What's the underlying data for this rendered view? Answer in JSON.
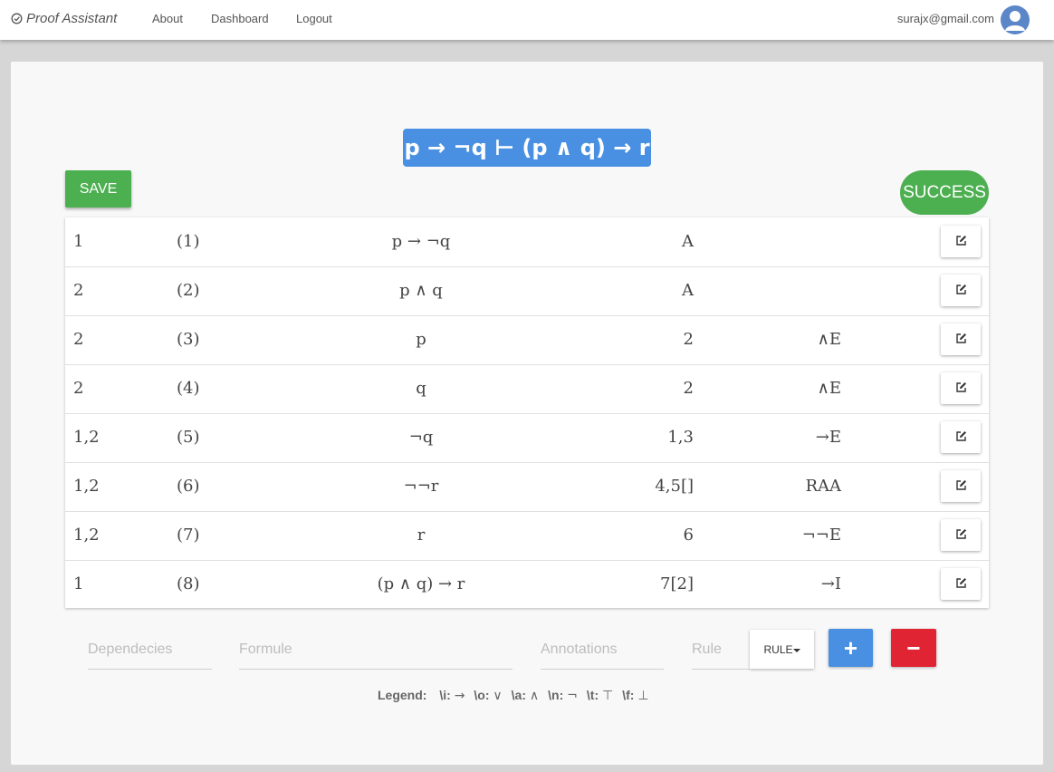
{
  "navbar": {
    "brand": "Proof Assistant",
    "links": [
      "About",
      "Dashboard",
      "Logout"
    ],
    "user_email": "surajx@gmail.com"
  },
  "sequent": "p → ¬q ⊢ (p ∧ q) → r",
  "save_label": "SAVE",
  "status_label": "SUCCESS",
  "colors": {
    "sequent_bg": "#4a90e2",
    "save": "#4caf50",
    "success": "#4caf50",
    "add": "#4a90e2",
    "remove": "#e02433"
  },
  "proof": {
    "rows": [
      {
        "deps": "1",
        "line": "(1)",
        "formula": "p → ¬q",
        "annotation": "A",
        "rule": ""
      },
      {
        "deps": "2",
        "line": "(2)",
        "formula": "p ∧ q",
        "annotation": "A",
        "rule": ""
      },
      {
        "deps": "2",
        "line": "(3)",
        "formula": "p",
        "annotation": "2",
        "rule": "∧E"
      },
      {
        "deps": "2",
        "line": "(4)",
        "formula": "q",
        "annotation": "2",
        "rule": "∧E"
      },
      {
        "deps": "1,2",
        "line": "(5)",
        "formula": "¬q",
        "annotation": "1,3",
        "rule": "→E"
      },
      {
        "deps": "1,2",
        "line": "(6)",
        "formula": "¬¬r",
        "annotation": "4,5[]",
        "rule": "RAA"
      },
      {
        "deps": "1,2",
        "line": "(7)",
        "formula": "r",
        "annotation": "6",
        "rule": "¬¬E"
      },
      {
        "deps": "1",
        "line": "(8)",
        "formula": "(p ∧ q) → r",
        "annotation": "7[2]",
        "rule": "→I"
      }
    ]
  },
  "input": {
    "deps_placeholder": "Dependecies",
    "formula_placeholder": "Formule",
    "annotation_placeholder": "Annotations",
    "rule_placeholder": "Rule",
    "rule_button": "RULE",
    "add_label": "+",
    "remove_label": "−"
  },
  "legend": {
    "title": "Legend:",
    "items": [
      {
        "key": "\\i:",
        "symbol": "→"
      },
      {
        "key": "\\o:",
        "symbol": "∨"
      },
      {
        "key": "\\a:",
        "symbol": "∧"
      },
      {
        "key": "\\n:",
        "symbol": "¬"
      },
      {
        "key": "\\t:",
        "symbol": "⊤"
      },
      {
        "key": "\\f:",
        "symbol": "⊥"
      }
    ]
  }
}
